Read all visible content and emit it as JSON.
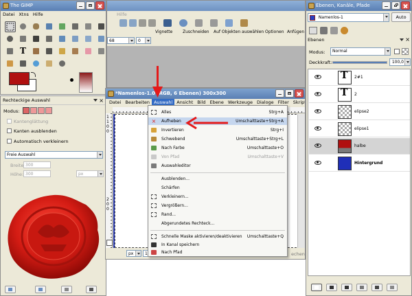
{
  "toolbox": {
    "title": "The GIMP",
    "menu": [
      "Datei",
      "Xtns",
      "Hilfe"
    ],
    "fg_color": "#b01010",
    "bg_color": "#ffffff"
  },
  "tool_options": {
    "title": "Rechteckige Auswahl",
    "mode_label": "Modus:",
    "antialias": "Kantenglättung",
    "feather": "Kanten ausblenden",
    "auto_shrink": "Automatisch verkleinern",
    "select_mode": "Freie Auswahl",
    "width_label": "Breite:",
    "height_label": "Höhe:",
    "width": "300",
    "height": "300",
    "unit": "px"
  },
  "background_toolbar": {
    "menu_label": "Hilfe",
    "zoom": "68",
    "offset": "0",
    "buttons": [
      "Vignette",
      "Zuschneiden",
      "Auf Objekten auswählen",
      "Optionen",
      "Anfügen"
    ]
  },
  "image_window": {
    "title": "*Namenlos-1.0 (RGB, 6 Ebenen) 300x300",
    "menu": [
      "Datei",
      "Bearbeiten",
      "Auswahl",
      "Ansicht",
      "Bild",
      "Ebene",
      "Werkzeuge",
      "Dialoge",
      "Filter",
      "Skript-Fu"
    ],
    "unit": "px",
    "zoom": "1.0",
    "status": "echen",
    "ruler_marks": [
      "1",
      "1",
      "0",
      "0",
      "2",
      "0",
      "0"
    ]
  },
  "auswahl_menu": {
    "items": [
      {
        "label": "Alles",
        "shortcut": "Strg+A",
        "disabled": false,
        "highlight": false
      },
      {
        "label": "Aufheben",
        "shortcut": "Umschalttaste+Strg+A",
        "disabled": false,
        "highlight": true
      },
      {
        "label": "Invertieren",
        "shortcut": "Strg+I",
        "disabled": false,
        "highlight": false
      },
      {
        "label": "Schwebend",
        "shortcut": "Umschalttaste+Strg+L",
        "disabled": false,
        "highlight": false
      },
      {
        "label": "Nach Farbe",
        "shortcut": "Umschalttaste+O",
        "disabled": false,
        "highlight": false
      },
      {
        "label": "Von Pfad",
        "shortcut": "Umschalttaste+V",
        "disabled": true,
        "highlight": false
      },
      {
        "label": "Auswahleditor",
        "shortcut": "",
        "disabled": false,
        "highlight": false
      },
      {
        "label": "Ausblenden...",
        "shortcut": "",
        "disabled": false,
        "highlight": false
      },
      {
        "label": "Schärfen",
        "shortcut": "",
        "disabled": false,
        "highlight": false
      },
      {
        "label": "Verkleinern...",
        "shortcut": "",
        "disabled": false,
        "highlight": false
      },
      {
        "label": "Vergrößern...",
        "shortcut": "",
        "disabled": false,
        "highlight": false
      },
      {
        "label": "Rand...",
        "shortcut": "",
        "disabled": false,
        "highlight": false
      },
      {
        "label": "Abgerundetes Rechteck...",
        "shortcut": "",
        "disabled": false,
        "highlight": false
      },
      {
        "label": "Schnelle Maske aktivieren/deaktivieren",
        "shortcut": "Umschalttaste+Q",
        "disabled": false,
        "highlight": false
      },
      {
        "label": "In Kanal speichern",
        "shortcut": "",
        "disabled": false,
        "highlight": false
      },
      {
        "label": "Nach Pfad",
        "shortcut": "",
        "disabled": false,
        "highlight": false
      }
    ]
  },
  "layers_panel": {
    "title": "Ebenen, Kanäle, Pfade",
    "image_name": "Namenlos-1",
    "auto_label": "Auto",
    "tab_label": "Ebenen",
    "mode_label": "Modus:",
    "mode_value": "Normal",
    "opacity_label": "Deckkraft:",
    "opacity_value": "100,0",
    "opacity_fraction": 1.0,
    "layers": [
      {
        "name": "2#1",
        "type": "text"
      },
      {
        "name": "2",
        "type": "text"
      },
      {
        "name": "elipse2",
        "type": "transparent"
      },
      {
        "name": "elipse1",
        "type": "transparent"
      },
      {
        "name": "halbe",
        "type": "red"
      },
      {
        "name": "Hintergrund",
        "type": "blue"
      }
    ]
  },
  "colors": {
    "title_blue": "#5a7fb4",
    "arrow_red": "#e41a1a",
    "highlight": "#c5d6ee",
    "seal_red": "#c41414"
  }
}
